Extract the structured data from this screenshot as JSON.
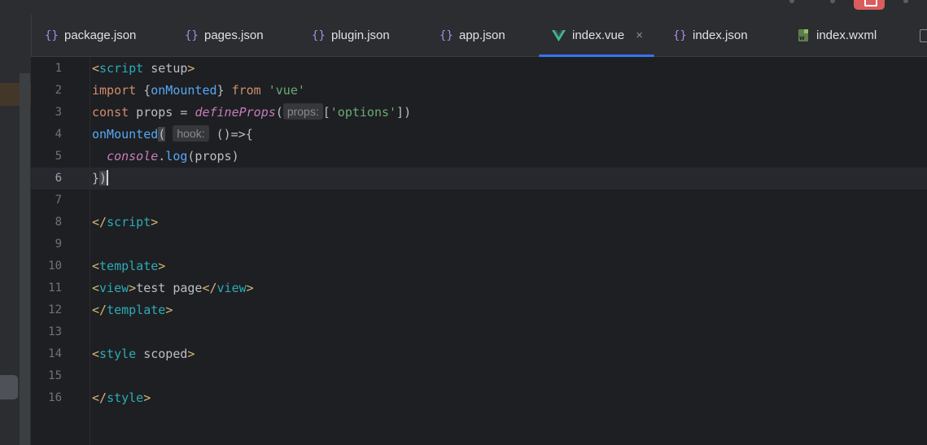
{
  "tabs": [
    {
      "label": "package.json",
      "icon": "{}",
      "active": false
    },
    {
      "label": "pages.json",
      "icon": "{}",
      "active": false
    },
    {
      "label": "plugin.json",
      "icon": "{}",
      "active": false
    },
    {
      "label": "app.json",
      "icon": "{}",
      "active": false
    },
    {
      "label": "index.vue",
      "icon": "vue",
      "active": true,
      "close": "×"
    },
    {
      "label": "index.json",
      "icon": "{}",
      "active": false
    },
    {
      "label": "index.wxml",
      "icon": "wxml",
      "active": false
    }
  ],
  "wxml_badge": "W",
  "editor": {
    "current_line": 6,
    "line_numbers": [
      "1",
      "2",
      "3",
      "4",
      "5",
      "6",
      "7",
      "8",
      "9",
      "10",
      "11",
      "12",
      "13",
      "14",
      "15",
      "16"
    ],
    "hints": {
      "props": "props:",
      "hook": "hook:"
    }
  },
  "code": {
    "l1": {
      "open": "<",
      "tag": "script",
      "rest": " setup",
      "close": ">"
    },
    "l2": {
      "kw1": "import",
      "brace_open": " {",
      "fn": "onMounted",
      "brace_close": "} ",
      "kw2": "from",
      "sp": " ",
      "str": "'vue'"
    },
    "l3": {
      "kw": "const",
      "mid": " props = ",
      "fn": "defineProps",
      "paren": "(",
      "arr_open": "[",
      "str": "'options'",
      "arr_close": "])"
    },
    "l4": {
      "fn": "onMounted",
      "paren": "(",
      "rest": "()=>{"
    },
    "l5": {
      "indent": "  ",
      "obj": "console",
      "dot": ".",
      "fn": "log",
      "rest": "(props)"
    },
    "l6": {
      "brace": "}",
      "paren": ")"
    },
    "l8": {
      "open": "</",
      "tag": "script",
      "close": ">"
    },
    "l10": {
      "open": "<",
      "tag": "template",
      "close": ">"
    },
    "l11": {
      "open": "<",
      "tag": "view",
      "close": ">",
      "text": "test page",
      "open2": "</",
      "tag2": "view",
      "close2": ">"
    },
    "l12": {
      "open": "</",
      "tag": "template",
      "close": ">"
    },
    "l14": {
      "open": "<",
      "tag": "style",
      "rest": " scoped",
      "close": ">"
    },
    "l16": {
      "open": "</",
      "tag": "style",
      "close": ">"
    }
  },
  "colors": {
    "accent": "#3574f0",
    "background": "#1e1f22",
    "panel": "#2b2d30"
  }
}
